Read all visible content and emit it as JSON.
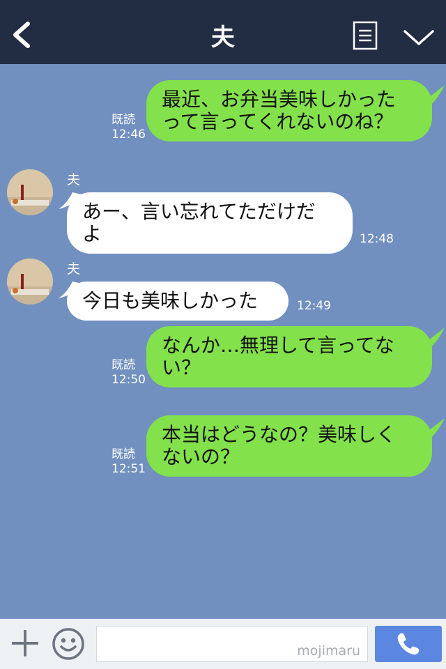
{
  "header": {
    "title": "夫"
  },
  "messages": [
    {
      "side": "sent",
      "lines": [
        "最近、お弁当美味しかった",
        "って言ってくれないのね？"
      ],
      "read": "既読",
      "time": "12:46"
    },
    {
      "side": "received",
      "sender": "夫",
      "lines": [
        "あー、言い忘れてただけだ",
        "よ"
      ],
      "time": "12:48"
    },
    {
      "side": "received",
      "sender": "夫",
      "lines": [
        "今日も美味しかった"
      ],
      "time": "12:49"
    },
    {
      "side": "sent",
      "lines": [
        "なんか…無理して言ってな",
        "い？"
      ],
      "read": "既読",
      "time": "12:50"
    },
    {
      "side": "sent",
      "lines": [
        "本当はどうなの？美味しく",
        "ないの？"
      ],
      "read": "既読",
      "time": "12:51"
    }
  ],
  "footer": {
    "watermark": "mojimaru"
  },
  "colors": {
    "header_bg": "#222c43",
    "chat_bg": "#7190c0",
    "sent_bubble": "#83e14b",
    "received_bubble": "#ffffff",
    "call_button": "#5b87e0"
  }
}
